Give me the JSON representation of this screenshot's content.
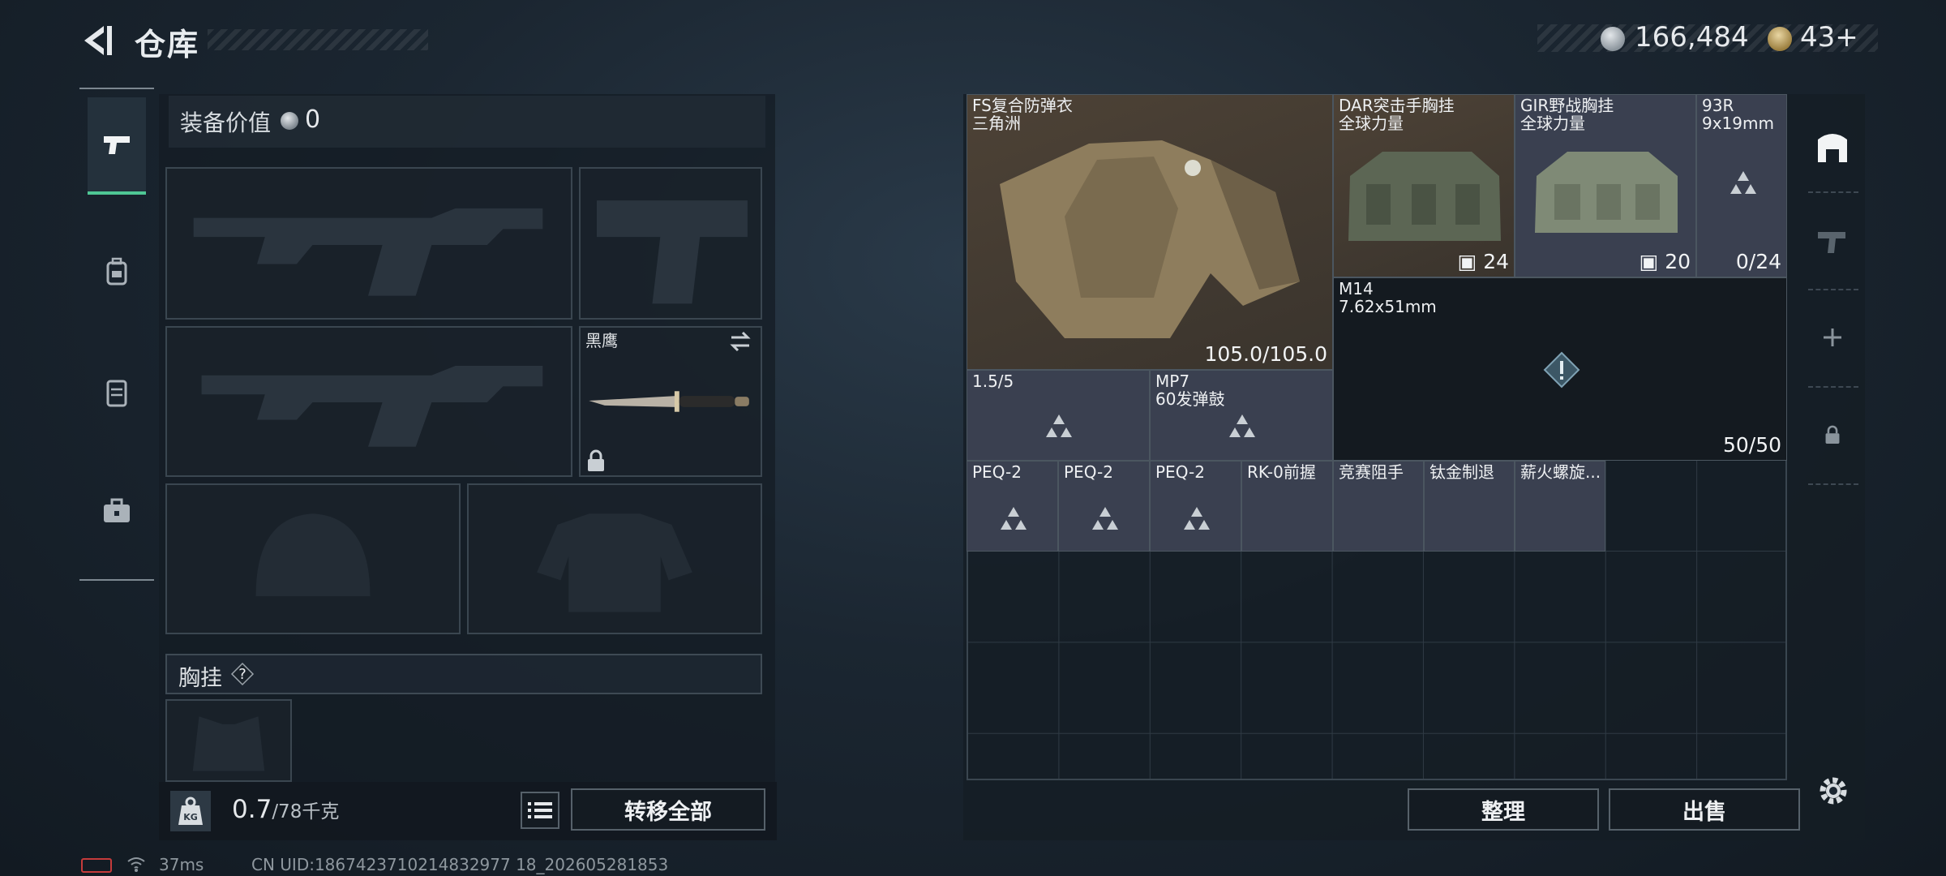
{
  "header": {
    "title": "仓库",
    "coins": "166,484",
    "tokens": "43",
    "tokens_plus": "+"
  },
  "nav": {
    "items": [
      "weapons-icon",
      "backpack-icon",
      "armor-icon",
      "toolbox-icon"
    ],
    "active": "weapons-icon"
  },
  "loadout": {
    "equipment_value_label": "装备价值",
    "equipment_value": "0",
    "knife_label": "黑鹰",
    "chest_rig_label": "胸挂",
    "help_mark": "?"
  },
  "capacity": {
    "weight_current": "0.7",
    "weight_max": "/78千克",
    "weight_icon_label": "KG"
  },
  "buttons": {
    "transfer_all": "转移全部",
    "sort": "整理",
    "sell": "出售"
  },
  "status": {
    "ping": "37ms",
    "uid": "CN UID:1867423710214832977 18_202605281853"
  },
  "stash": {
    "items": [
      {
        "id": "fs-armor",
        "name": "FS复合防弹衣",
        "sub": "三角洲",
        "value": "105.0/105.0",
        "bg": "brown"
      },
      {
        "id": "dar-rig",
        "name": "DAR突击手胸挂",
        "sub": "全球力量",
        "value": "24",
        "bg": "brown"
      },
      {
        "id": "gir-rig",
        "name": "GIR野战胸挂",
        "sub": "全球力量",
        "value": "20",
        "bg": "grey"
      },
      {
        "id": "93r",
        "name": "93R",
        "sub": "9x19mm",
        "value": "0/24",
        "bg": "grey"
      },
      {
        "id": "m14",
        "name": "M14",
        "sub": "7.62x51mm",
        "value": "50/50",
        "bg": "dark"
      },
      {
        "id": "15-5",
        "name": "1.5/5",
        "sub": "",
        "value": "",
        "bg": "grey"
      },
      {
        "id": "mp7-mag",
        "name": "MP7",
        "sub": "60发弹鼓",
        "value": "",
        "bg": "grey"
      },
      {
        "id": "peq1",
        "name": "PEQ-2",
        "sub": "",
        "value": "",
        "bg": "grey"
      },
      {
        "id": "peq2",
        "name": "PEQ-2",
        "sub": "",
        "value": "",
        "bg": "grey"
      },
      {
        "id": "peq3",
        "name": "PEQ-2",
        "sub": "",
        "value": "",
        "bg": "grey"
      },
      {
        "id": "rk0",
        "name": "RK-0前握",
        "sub": "",
        "value": "",
        "bg": "grey"
      },
      {
        "id": "comp",
        "name": "竞赛阻手",
        "sub": "",
        "value": "",
        "bg": "grey"
      },
      {
        "id": "ti",
        "name": "钛金制退",
        "sub": "",
        "value": "",
        "bg": "grey"
      },
      {
        "id": "fire",
        "name": "薪火螺旋...",
        "sub": "",
        "value": "",
        "bg": "grey"
      }
    ]
  },
  "colors": {
    "accent": "#4fc795",
    "brown_cell": "#4d4236",
    "grey_cell": "#3a4050"
  }
}
